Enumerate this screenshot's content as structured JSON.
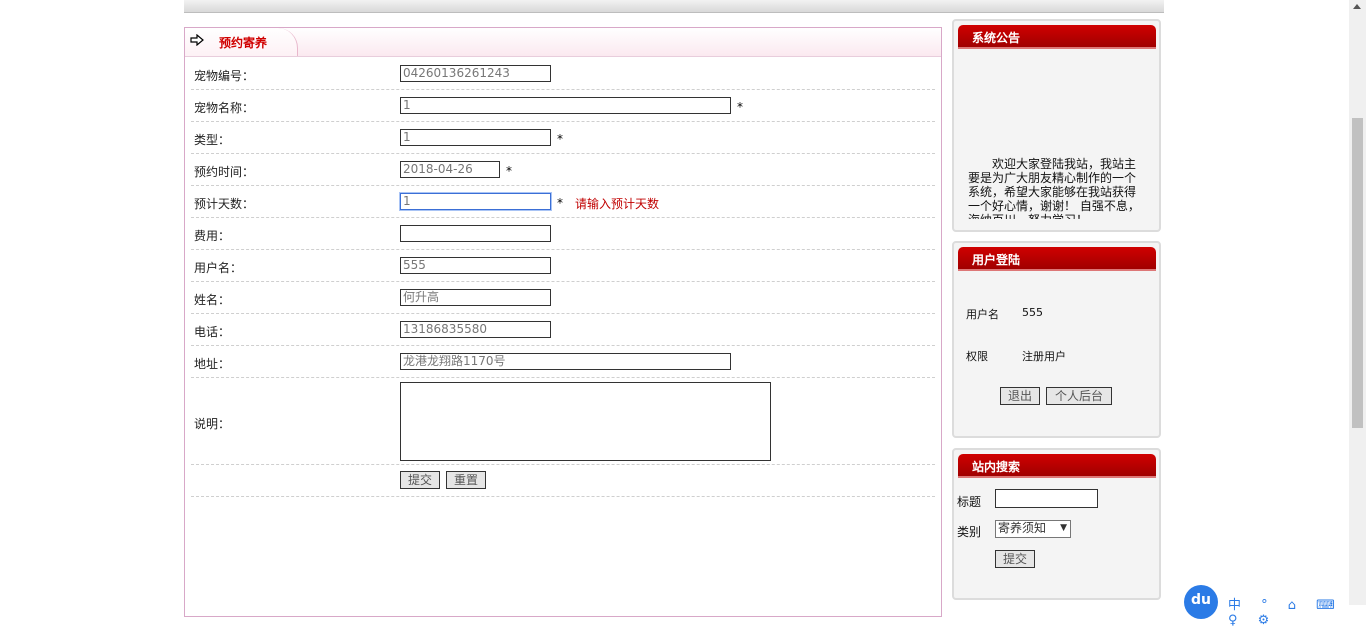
{
  "main": {
    "title": "预约寄养",
    "fields": {
      "pet_id": {
        "label": "宠物编号：",
        "value": "04260136261243"
      },
      "pet_name": {
        "label": "宠物名称：",
        "value": "1",
        "required": "*"
      },
      "type": {
        "label": "类型：",
        "value": "1",
        "required": "*"
      },
      "date": {
        "label": "预约时间：",
        "value": "2018-04-26",
        "required": "*"
      },
      "days": {
        "label": "预计天数：",
        "value": "1",
        "required": "*",
        "error": "请输入预计天数"
      },
      "fee": {
        "label": "费用：",
        "value": ""
      },
      "username": {
        "label": "用户名：",
        "value": "555"
      },
      "name": {
        "label": "姓名：",
        "value": "何升高"
      },
      "phone": {
        "label": "电话：",
        "value": "13186835580"
      },
      "address": {
        "label": "地址：",
        "value": "龙港龙翔路1170号"
      },
      "note": {
        "label": "说明：",
        "value": ""
      }
    },
    "submit_label": "提交",
    "reset_label": "重置"
  },
  "notice": {
    "title": "系统公告",
    "text": "欢迎大家登陆我站，我站主要是为广大朋友精心制作的一个系统，希望大家能够在我站获得一个好心情，谢谢！ 自强不息，海纳百川，努力学习！"
  },
  "login": {
    "title": "用户登陆",
    "username_label": "用户名",
    "username_value": "555",
    "role_label": "权限",
    "role_value": "注册用户",
    "logout_label": "退出",
    "backend_label": "个人后台"
  },
  "search": {
    "title": "站内搜索",
    "title_label": "标题",
    "title_value": "",
    "category_label": "类别",
    "category_value": "寄养须知",
    "submit_label": "提交"
  },
  "widget": {
    "logo_text": "du",
    "tools_text": "中 ° ⌂ ⌨ ♀ ⚙"
  }
}
